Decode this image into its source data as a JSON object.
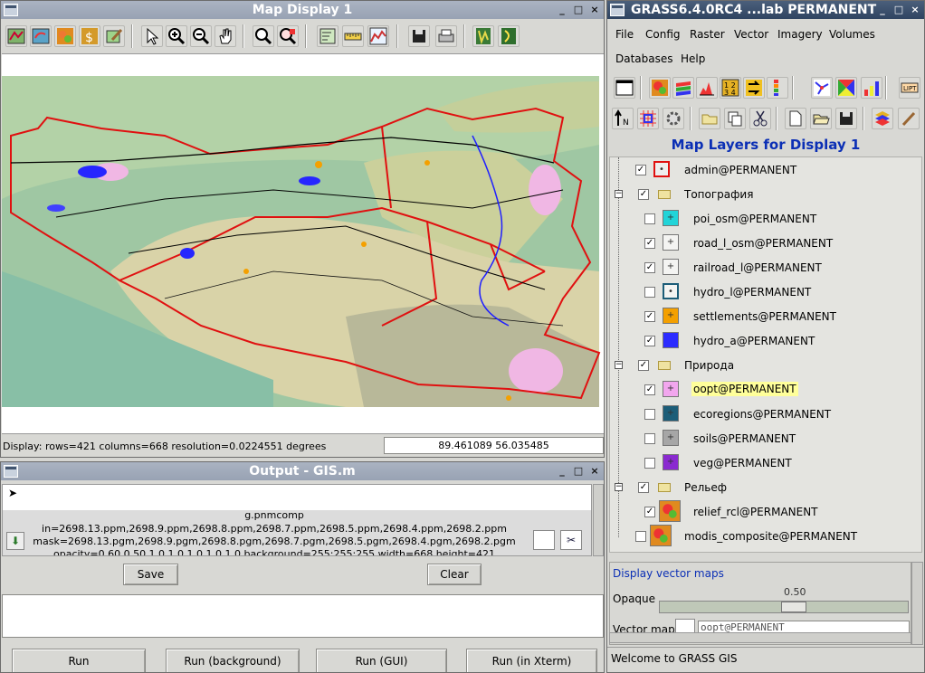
{
  "map_window": {
    "title": "Map Display 1",
    "status_left": "Display: rows=421 columns=668  resolution=0.0224551 degrees",
    "coords": "89.461089 56.035485"
  },
  "output_window": {
    "title": "Output - GIS.m",
    "lines": [
      "g.pnmcomp",
      "in=2698.13.ppm,2698.9.ppm,2698.8.ppm,2698.7.ppm,2698.5.ppm,2698.4.ppm,2698.2.ppm",
      "mask=2698.13.pgm,2698.9.pgm,2698.8.pgm,2698.7.pgm,2698.5.pgm,2698.4.pgm,2698.2.pgm",
      "opacity=0.60,0.50,1.0,1.0,1.0,1.0,1.0 background=255:255:255 width=668 height=421"
    ],
    "save_label": "Save",
    "clear_label": "Clear",
    "run_buttons": [
      "Run",
      "Run (background)",
      "Run (GUI)",
      "Run (in Xterm)"
    ]
  },
  "gis_window": {
    "title": "GRASS6.4.0RC4 ...lab PERMANENT",
    "menu": [
      "File",
      "Config",
      "Raster",
      "Vector",
      "Imagery",
      "Volumes",
      "Databases",
      "Help"
    ],
    "layers_title": "Map Layers for Display 1",
    "layers": [
      {
        "label": "admin@PERMANENT",
        "checked": true,
        "color": "#e8e8e6",
        "mark": "•"
      },
      {
        "label": "Топография",
        "checked": true,
        "group": true
      },
      {
        "label": "poi_osm@PERMANENT",
        "checked": false,
        "color": "#22d4d8",
        "mark": "+"
      },
      {
        "label": "road_l_osm@PERMANENT",
        "checked": true,
        "color": "#f4f4f2",
        "mark": "+"
      },
      {
        "label": "railroad_l@PERMANENT",
        "checked": true,
        "color": "#f4f4f2",
        "mark": "+"
      },
      {
        "label": "hydro_l@PERMANENT",
        "checked": false,
        "color": "#f4f4f2",
        "mark": "•"
      },
      {
        "label": "settlements@PERMANENT",
        "checked": true,
        "color": "#f4a000",
        "mark": "+"
      },
      {
        "label": "hydro_a@PERMANENT",
        "checked": true,
        "color": "#2b2bff",
        "mark": ""
      },
      {
        "label": "Природа",
        "checked": true,
        "group": true
      },
      {
        "label": "oopt@PERMANENT",
        "checked": true,
        "color": "#f2a6ee",
        "mark": "+",
        "selected": true
      },
      {
        "label": "ecoregions@PERMANENT",
        "checked": false,
        "color": "#1c5d78",
        "mark": "+"
      },
      {
        "label": "soils@PERMANENT",
        "checked": false,
        "color": "#a6a6a6",
        "mark": "+"
      },
      {
        "label": "veg@PERMANENT",
        "checked": false,
        "color": "#8a2ad0",
        "mark": "+"
      },
      {
        "label": "Рельеф",
        "checked": true,
        "group": true
      },
      {
        "label": "relief_rcl@PERMANENT",
        "checked": true,
        "raster": true
      },
      {
        "label": "modis_composite@PERMANENT",
        "checked": false,
        "raster": true
      }
    ],
    "props_title": "Display vector maps",
    "opaque_label": "Opaque",
    "opacity_value": "0.50",
    "vector_map_label": "Vector map:",
    "vector_map_value": "oopt@PERMANENT",
    "status": "Welcome to GRASS GIS"
  }
}
